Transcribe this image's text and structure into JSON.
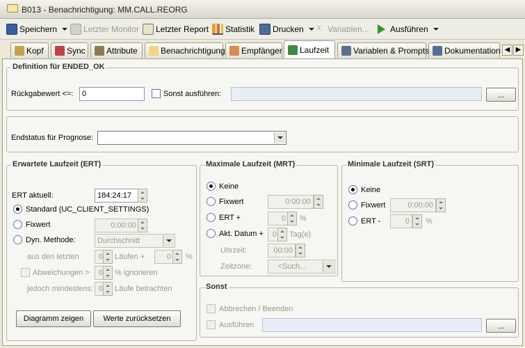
{
  "window": {
    "title": "B013 - Benachrichtigung: MM.CALL.REORG"
  },
  "toolbar": {
    "save": "Speichern",
    "last_monitor": "Letzter Monitor",
    "last_report": "Letzter Report",
    "statistics": "Statistik",
    "print": "Drucken",
    "variables": "Variablen...",
    "execute": "Ausführen"
  },
  "tabs": [
    "Kopf",
    "Sync",
    "Attribute",
    "Benachrichtigung",
    "Empfänger",
    "Laufzeit",
    "Variablen & Prompts",
    "Dokumentation"
  ],
  "tab_scroll": {
    "left": "◀",
    "right": "▶"
  },
  "ended_ok": {
    "legend": "Definition für ENDED_OK",
    "return_label": "Rückgabewert <=:",
    "return_value": "0",
    "else_label": "Sonst ausführen:",
    "else_value": "",
    "browse": "..."
  },
  "forecast": {
    "label": "Endstatus für Prognose:",
    "value": ""
  },
  "ert": {
    "legend": "Erwartete Laufzeit (ERT)",
    "current_label": "ERT aktuell:",
    "current_value": "184:24:17",
    "standard": "Standard (UC_CLIENT_SETTINGS)",
    "fixed": "Fixwert",
    "fixed_value": "0:00:00",
    "dyn": "Dyn. Methode:",
    "dyn_value": "Durchschnitt",
    "last_runs_label": "aus den letzten",
    "last_runs_value": "0",
    "runs_plus": "Läufen +",
    "plus_value": "0",
    "percent": "%",
    "deviations": "Abweichungen >",
    "dev_value": "0",
    "ignore": "% ignorieren",
    "min_label": "jedoch mindestens:",
    "min_value": "0",
    "consider": "Läufe betrachten",
    "diagram": "Diagramm zeigen",
    "reset": "Werte zurücksetzen"
  },
  "mrt": {
    "legend": "Maximale Laufzeit (MRT)",
    "none": "Keine",
    "fixed": "Fixwert",
    "fixed_value": "0:00:00",
    "ert_plus": "ERT +",
    "ert_value": "0",
    "percent": "%",
    "date": "Akt. Datum +",
    "date_value": "0",
    "days": "Tag(e)",
    "time_label": "Uhrzeit:",
    "time_value": "00:00",
    "zone_label": "Zeitzone:",
    "zone_value": "<Such..."
  },
  "srt": {
    "legend": "Minimale Laufzeit (SRT)",
    "none": "Keine",
    "fixed": "Fixwert",
    "fixed_value": "0:00:00",
    "ert_minus": "ERT -",
    "ert_value": "0",
    "percent": "%"
  },
  "else_group": {
    "legend": "Sonst",
    "abort": "Abbrechen / Beenden",
    "execute": "Ausführen",
    "execute_value": "",
    "browse": "..."
  }
}
